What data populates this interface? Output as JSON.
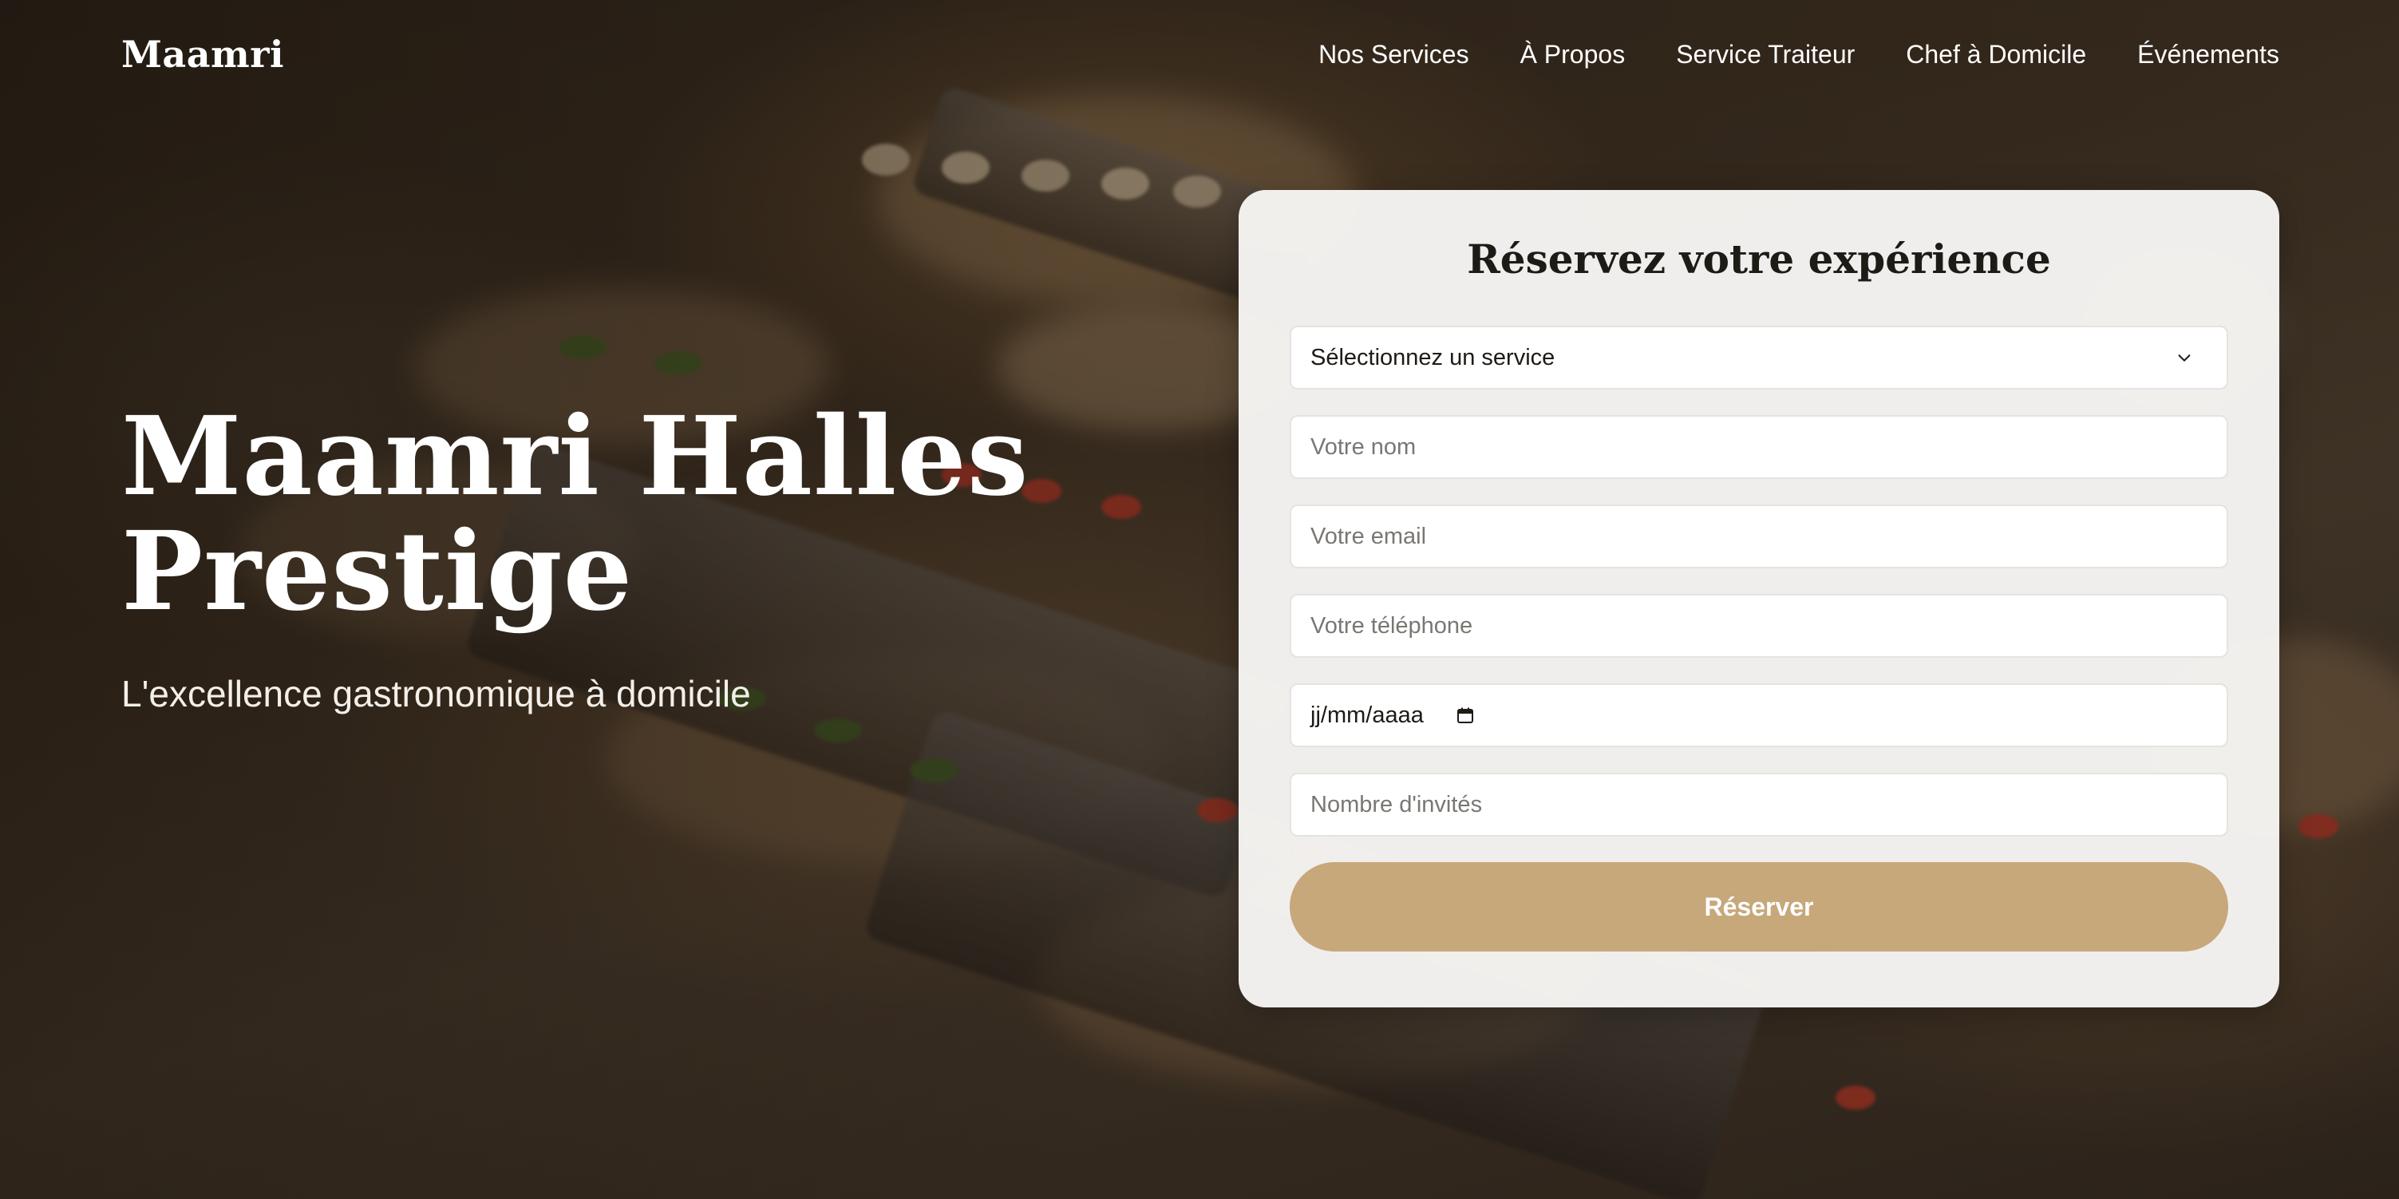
{
  "nav": {
    "logo": "Maamri",
    "links": [
      {
        "label": "Nos Services"
      },
      {
        "label": "À Propos"
      },
      {
        "label": "Service Traiteur"
      },
      {
        "label": "Chef à Domicile"
      },
      {
        "label": "Événements"
      }
    ]
  },
  "hero": {
    "title_line1": "Maamri Halles",
    "title_line2": "Prestige",
    "subtitle": "L'excellence gastronomique à domicile"
  },
  "booking": {
    "title": "Réservez votre expérience",
    "service_select": {
      "selected": "Sélectionnez un service",
      "icon": "chevron-down-icon"
    },
    "name_placeholder": "Votre nom",
    "email_placeholder": "Votre email",
    "phone_placeholder": "Votre téléphone",
    "date_value": "jj/mm/aaaa",
    "date_icon": "calendar-icon",
    "guests_placeholder": "Nombre d'invités",
    "submit_label": "Réserver"
  },
  "colors": {
    "accent": "#c7a87b",
    "card_background": "#f6f5f3",
    "text_dark": "#1e1a16",
    "placeholder": "#7a7773"
  }
}
